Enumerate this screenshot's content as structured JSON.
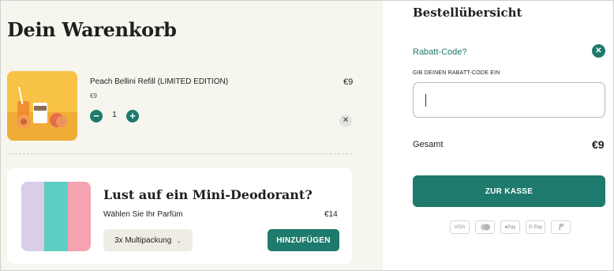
{
  "cart": {
    "title": "Dein Warenkorb",
    "item": {
      "name": "Peach Bellini Refill (LIMITED EDITION)",
      "unit_price": "€9",
      "total_price": "€9",
      "quantity": "1",
      "minus_icon": "minus-icon",
      "plus_icon": "plus-icon",
      "remove_icon": "close-icon",
      "image": "product-photo-peach-bellini"
    },
    "upsell": {
      "title": "Lust auf ein Mini-Deodorant?",
      "subtitle": "Wählen Sie Ihr Parfüm",
      "price": "€14",
      "variant_selected": "3x Multipackung",
      "add_label": "HINZUFÜGEN",
      "image": "product-photo-mini-deodorants"
    }
  },
  "summary": {
    "title": "Bestellübersicht",
    "discount_link": "Rabatt-Code?",
    "discount_field_label": "GIB DEINEN RABATT-CODE EIN",
    "discount_value": "",
    "total_label": "Gesamt",
    "total_value": "€9",
    "checkout_label": "ZUR KASSE",
    "payment_methods": [
      "VISA",
      "Mastercard",
      "Apple Pay",
      "Google Pay",
      "PayPal"
    ]
  },
  "colors": {
    "accent": "#1e7a6c",
    "cart_background": "#f6f5ee",
    "card_background": "#ffffff"
  }
}
